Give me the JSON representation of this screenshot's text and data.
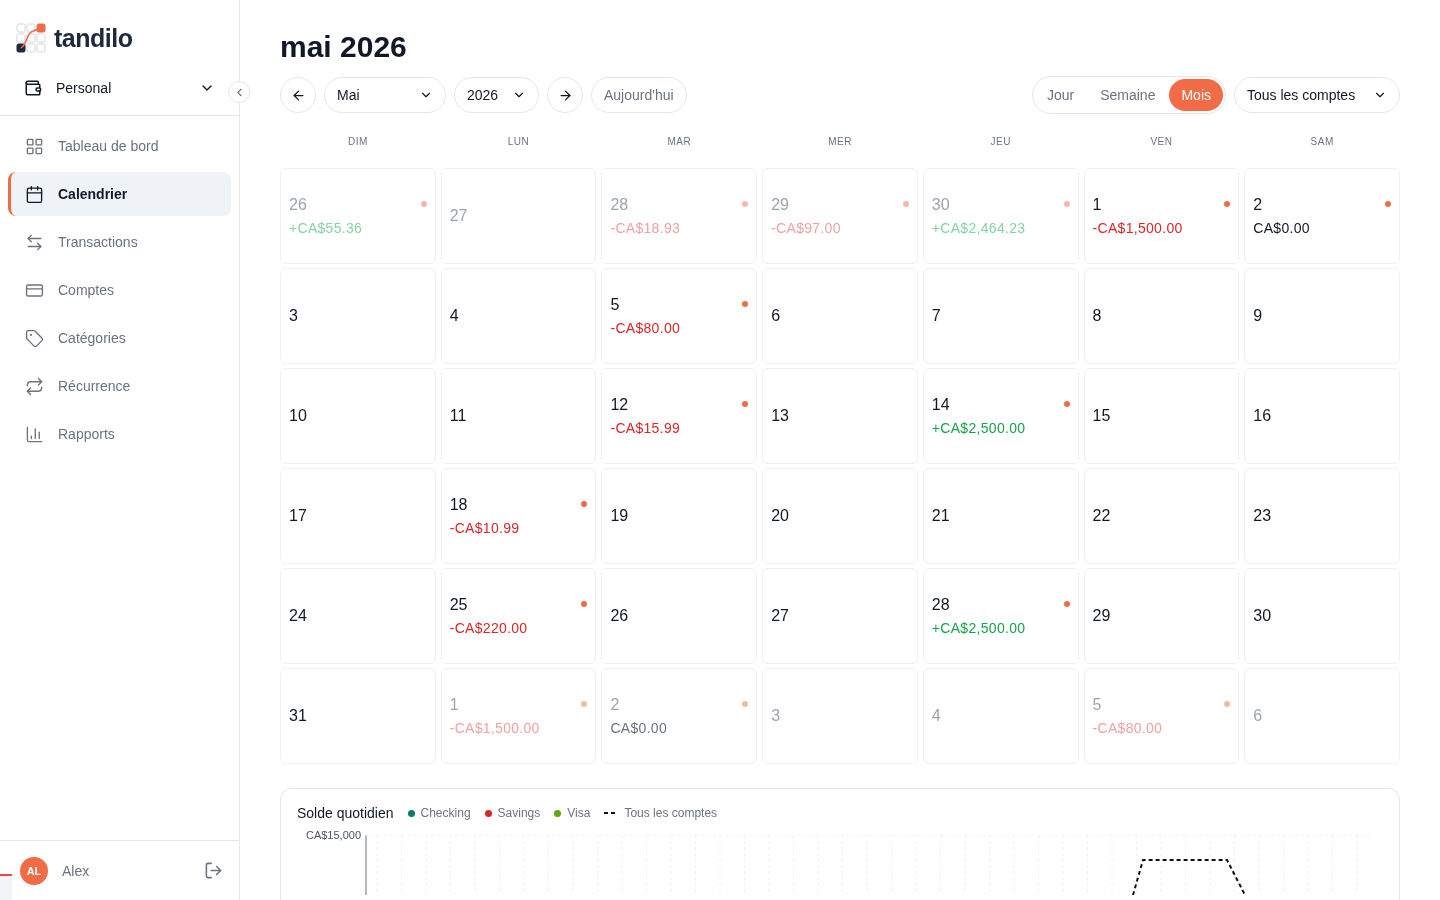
{
  "brand": {
    "name": "tandilo"
  },
  "workspace": {
    "label": "Personal"
  },
  "nav": [
    {
      "label": "Tableau de bord",
      "selected": false
    },
    {
      "label": "Calendrier",
      "selected": true
    },
    {
      "label": "Transactions",
      "selected": false
    },
    {
      "label": "Comptes",
      "selected": false
    },
    {
      "label": "Catégories",
      "selected": false
    },
    {
      "label": "Récurrence",
      "selected": false
    },
    {
      "label": "Rapports",
      "selected": false
    }
  ],
  "user": {
    "initials": "AL",
    "name": "Alex"
  },
  "title": "mai 2026",
  "toolbar": {
    "month": "Mai",
    "year": "2026",
    "today": "Aujourd'hui",
    "views": [
      {
        "label": "Jour",
        "selected": false
      },
      {
        "label": "Semaine",
        "selected": false
      },
      {
        "label": "Mois",
        "selected": true
      }
    ],
    "account": "Tous les comptes"
  },
  "weekdays": [
    "DIM",
    "LUN",
    "MAR",
    "MER",
    "JEU",
    "VEN",
    "SAM"
  ],
  "weeks": [
    [
      {
        "day": "26",
        "outside": true,
        "amount": "+CA$55.36",
        "kind": "income"
      },
      {
        "day": "27",
        "outside": true
      },
      {
        "day": "28",
        "outside": true,
        "amount": "-CA$18.93",
        "kind": "expense"
      },
      {
        "day": "29",
        "outside": true,
        "amount": "-CA$97.00",
        "kind": "expense"
      },
      {
        "day": "30",
        "outside": true,
        "amount": "+CA$2,464.23",
        "kind": "income"
      },
      {
        "day": "1",
        "outside": false,
        "amount": "-CA$1,500.00",
        "kind": "expense"
      },
      {
        "day": "2",
        "outside": false,
        "amount": "CA$0.00",
        "kind": "zero"
      }
    ],
    [
      {
        "day": "3",
        "outside": false
      },
      {
        "day": "4",
        "outside": false
      },
      {
        "day": "5",
        "outside": false,
        "amount": "-CA$80.00",
        "kind": "expense"
      },
      {
        "day": "6",
        "outside": false
      },
      {
        "day": "7",
        "outside": false
      },
      {
        "day": "8",
        "outside": false
      },
      {
        "day": "9",
        "outside": false
      }
    ],
    [
      {
        "day": "10",
        "outside": false
      },
      {
        "day": "11",
        "outside": false
      },
      {
        "day": "12",
        "outside": false,
        "amount": "-CA$15.99",
        "kind": "expense"
      },
      {
        "day": "13",
        "outside": false
      },
      {
        "day": "14",
        "outside": false,
        "amount": "+CA$2,500.00",
        "kind": "income"
      },
      {
        "day": "15",
        "outside": false
      },
      {
        "day": "16",
        "outside": false
      }
    ],
    [
      {
        "day": "17",
        "outside": false
      },
      {
        "day": "18",
        "outside": false,
        "amount": "-CA$10.99",
        "kind": "expense"
      },
      {
        "day": "19",
        "outside": false
      },
      {
        "day": "20",
        "outside": false
      },
      {
        "day": "21",
        "outside": false
      },
      {
        "day": "22",
        "outside": false
      },
      {
        "day": "23",
        "outside": false
      }
    ],
    [
      {
        "day": "24",
        "outside": false
      },
      {
        "day": "25",
        "outside": false,
        "amount": "-CA$220.00",
        "kind": "expense"
      },
      {
        "day": "26",
        "outside": false
      },
      {
        "day": "27",
        "outside": false
      },
      {
        "day": "28",
        "outside": false,
        "amount": "+CA$2,500.00",
        "kind": "income"
      },
      {
        "day": "29",
        "outside": false
      },
      {
        "day": "30",
        "outside": false
      }
    ],
    [
      {
        "day": "31",
        "outside": false
      },
      {
        "day": "1",
        "outside": true,
        "amount": "-CA$1,500.00",
        "kind": "expense"
      },
      {
        "day": "2",
        "outside": true,
        "amount": "CA$0.00",
        "kind": "zero"
      },
      {
        "day": "3",
        "outside": true
      },
      {
        "day": "4",
        "outside": true
      },
      {
        "day": "5",
        "outside": true,
        "amount": "-CA$80.00",
        "kind": "expense"
      },
      {
        "day": "6",
        "outside": true
      }
    ]
  ],
  "balance_chart": {
    "title": "Solde quotidien",
    "legend": [
      {
        "label": "Checking",
        "kind": "dot",
        "color": "#0f766e"
      },
      {
        "label": "Savings",
        "kind": "dot",
        "color": "#dc2626"
      },
      {
        "label": "Visa",
        "kind": "dot",
        "color": "#65a30d"
      },
      {
        "label": "Tous les comptes",
        "kind": "dash",
        "color": "#111111"
      }
    ],
    "y_tick": "CA$15,000"
  }
}
